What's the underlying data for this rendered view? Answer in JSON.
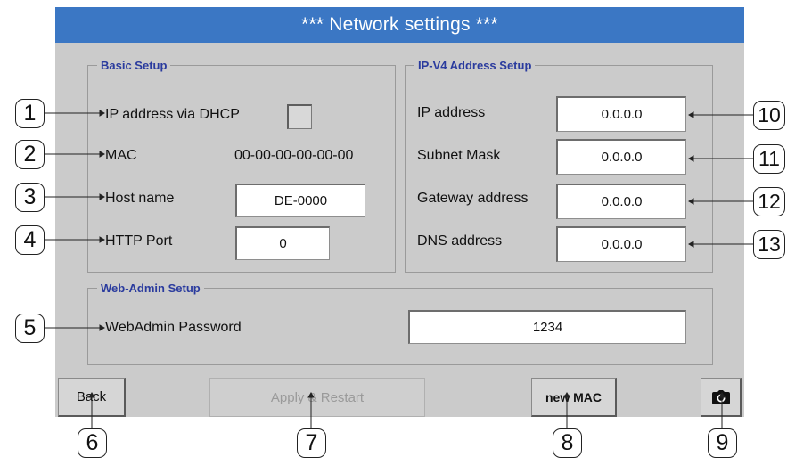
{
  "window": {
    "title": "*** Network settings ***"
  },
  "basic_setup": {
    "legend": "Basic Setup",
    "dhcp_label": "IP address via DHCP",
    "dhcp_checked": false,
    "mac_label": "MAC",
    "mac_value": "00-00-00-00-00-00",
    "host_label": "Host name",
    "host_value": "DE-0000",
    "http_label": "HTTP Port",
    "http_value": "0"
  },
  "ipv4_setup": {
    "legend": "IP-V4 Address Setup",
    "ip_label": "IP address",
    "ip_value": "0.0.0.0",
    "subnet_label": "Subnet Mask",
    "subnet_value": "0.0.0.0",
    "gateway_label": "Gateway address",
    "gateway_value": "0.0.0.0",
    "dns_label": "DNS address",
    "dns_value": "0.0.0.0"
  },
  "webadmin_setup": {
    "legend": "Web-Admin Setup",
    "password_label": "WebAdmin Password",
    "password_value": "1234"
  },
  "buttons": {
    "back": "Back",
    "apply": "Apply & Restart",
    "new_mac": "new MAC",
    "screenshot_icon": "camera-icon"
  },
  "callouts": [
    "1",
    "2",
    "3",
    "4",
    "5",
    "6",
    "7",
    "8",
    "9",
    "10",
    "11",
    "12",
    "13"
  ],
  "colors": {
    "title_bar": "#3b77c4",
    "panel_bg": "#cbcbcb",
    "legend_text": "#2a3b9e"
  }
}
